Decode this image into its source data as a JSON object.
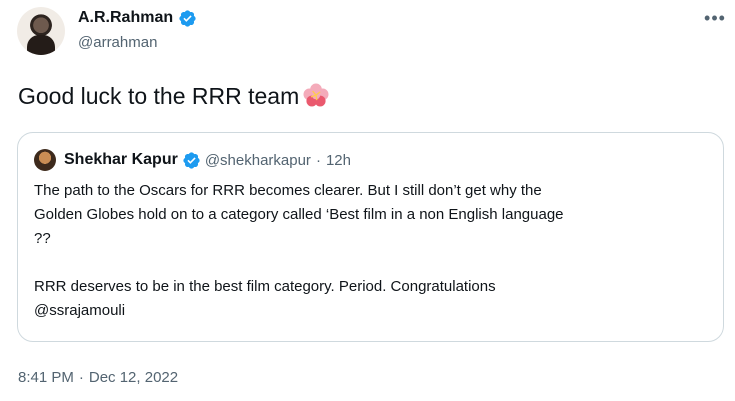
{
  "author": {
    "display_name": "A.R.Rahman",
    "handle": "@arrahman"
  },
  "tweet": {
    "text": "Good luck to the RRR team",
    "emoji": "hibiscus-flower-icon"
  },
  "quoted": {
    "display_name": "Shekhar Kapur",
    "handle": "@shekharkapur",
    "dot": "·",
    "time": "12h",
    "lines": [
      "The path to the Oscars for RRR becomes clearer. But I still don’t get why the",
      "Golden Globes hold on to a category called ‘Best film in a non English language",
      "??"
    ],
    "lines2": [
      "RRR deserves to be in the best film category. Period. Congratulations",
      "@ssrajamouli"
    ]
  },
  "meta": {
    "time": "8:41 PM",
    "sep": "·",
    "date": "Dec 12, 2022"
  },
  "colors": {
    "verified": "#1d9bf0",
    "secondary_text": "#536471",
    "border": "#cfd9de"
  }
}
